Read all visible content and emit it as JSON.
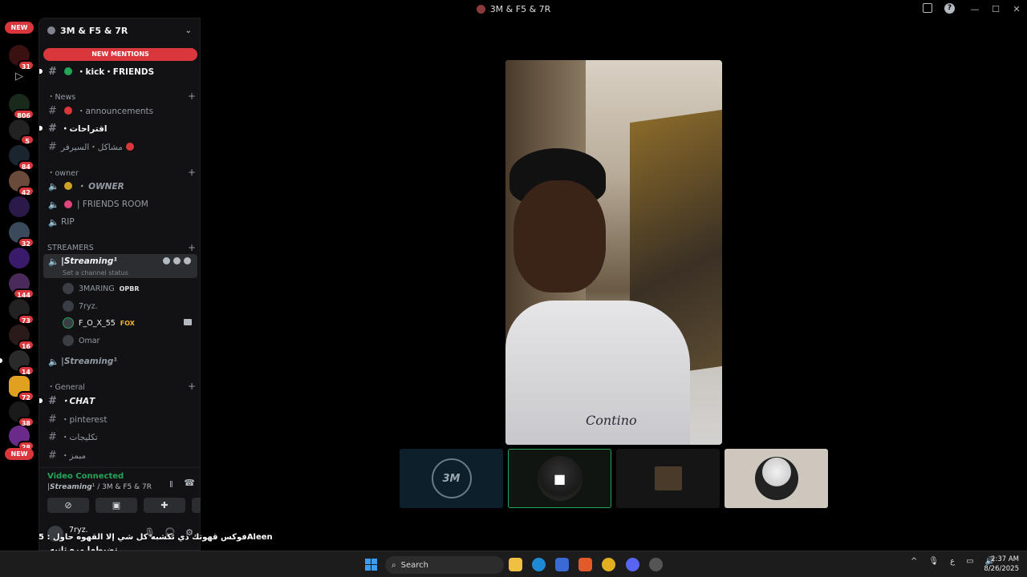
{
  "window": {
    "title": "3M & F5 & 7R"
  },
  "guilds": {
    "new_top": "NEW",
    "new_bottom": "NEW",
    "badges": [
      "31",
      "806",
      "5",
      "84",
      "42",
      "32",
      "144",
      "73",
      "16",
      "14",
      "72",
      "38",
      "28"
    ]
  },
  "server": {
    "name": "3M & F5 & 7R",
    "new_mentions": "NEW MENTIONS",
    "channels": {
      "kick": "・kick・FRIENDS",
      "cat_news": "・News",
      "announcements": "・announcements",
      "suggestions": "・اقتراحات",
      "problems": "مشاكل・السيرفر",
      "cat_owner": "・owner",
      "owner_vc": "・ OWNER",
      "friends_room": "| FRIENDS ROOM",
      "rip": "RIP",
      "cat_streamers": "STREAMERS",
      "streaming": "|𝙎𝙩𝙧𝙚𝙖𝙢𝙞𝙣𝙜¹",
      "streaming_status": "Set a channel status",
      "streaming2": "|𝙎𝙩𝙧𝙚𝙖𝙢𝙞𝙣𝙜¹",
      "cat_general": "・General",
      "chat": "・𝘾𝙃𝘼𝙏",
      "pinterest": "・pinterest",
      "talk": "・تكليجات",
      "mix": "・مبمز"
    },
    "voice_users": [
      {
        "name": "3MARING",
        "tag": "OPBR"
      },
      {
        "name": "7ryz.",
        "tag": ""
      },
      {
        "name": "F_O_X_55",
        "tag": "FOX"
      },
      {
        "name": "Omar",
        "tag": ""
      }
    ]
  },
  "voice_panel": {
    "status": "Video Connected",
    "channel": "|𝙎𝙩𝙧𝙚𝙖𝙢𝙞𝙣𝙜¹ / 3M & F5 & 7R"
  },
  "user": {
    "name": "7ryz."
  },
  "overlay": {
    "line1": "فوكس قهوتك ذي تكشبه كل شي إلا القهوه حاول : 5Aleen",
    "line2": "تضبطها مره ثانيه"
  },
  "video": {
    "shirt_logo": "Contino"
  },
  "thumbs": {
    "t1_label": "3M"
  },
  "taskbar": {
    "search": "Search",
    "lang": "ع",
    "time": "2:37 AM",
    "date": "8/26/2025"
  },
  "colors": {
    "accent_red": "#da373c",
    "connected_green": "#23a55a"
  }
}
